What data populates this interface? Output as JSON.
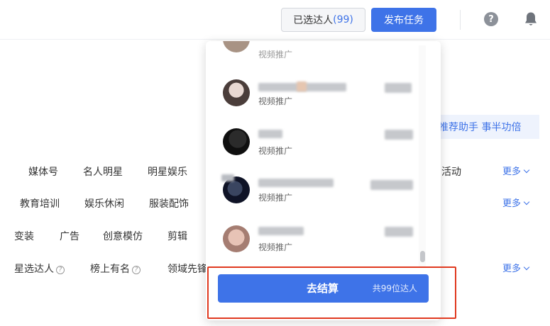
{
  "topbar": {
    "selected_label": "已选达人",
    "selected_count": "(99)",
    "publish_label": "发布任务",
    "help_icon": "question-circle-icon",
    "bell_icon": "bell-icon"
  },
  "assistant": {
    "label": "推荐助手 事半功倍"
  },
  "filters": {
    "row1": {
      "items": [
        "媒体号",
        "名人明星",
        "明星娱乐"
      ],
      "partial": "活动",
      "more": "更多"
    },
    "row2": {
      "items": [
        "教育培训",
        "娱乐休闲",
        "服装配饰"
      ],
      "more": "更多"
    },
    "row3": {
      "items": [
        "变装",
        "广告",
        "创意模仿",
        "剪辑"
      ]
    },
    "row4": {
      "items": [
        "星选达人",
        "榜上有名",
        "领域先锋"
      ],
      "more": "更多"
    }
  },
  "dropdown": {
    "items": [
      {
        "tag": "视频推广"
      },
      {
        "tag": "视频推广"
      },
      {
        "tag": "视频推广"
      },
      {
        "tag": "视频推广"
      },
      {
        "tag": "视频推广"
      }
    ],
    "checkout": {
      "label": "去结算",
      "total": "共99位达人"
    }
  },
  "colors": {
    "accent": "#3e73e8",
    "highlight": "#e0391f"
  }
}
